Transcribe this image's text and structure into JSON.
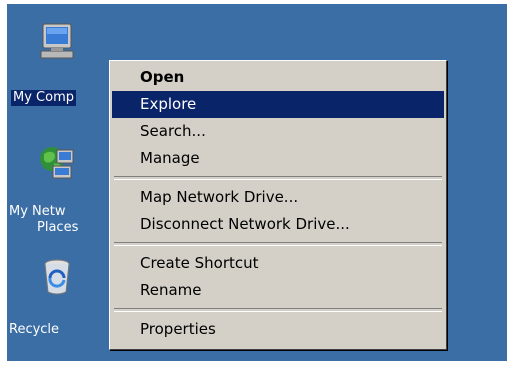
{
  "desktop": {
    "background_color": "#3a6ea5",
    "selection_color": "#0a246a",
    "icons": [
      {
        "label": "My Comp",
        "icon": "computer-icon"
      },
      {
        "label": "My Netw",
        "label2": "Places",
        "icon": "network-places-icon"
      },
      {
        "label": "Recycle",
        "icon": "recycle-bin-icon"
      }
    ]
  },
  "context_menu": {
    "groups": [
      [
        {
          "label": "Open",
          "bold": true,
          "selected": false
        },
        {
          "label": "Explore",
          "bold": false,
          "selected": true
        },
        {
          "label": "Search...",
          "bold": false,
          "selected": false
        },
        {
          "label": "Manage",
          "bold": false,
          "selected": false
        }
      ],
      [
        {
          "label": "Map Network Drive...",
          "bold": false,
          "selected": false
        },
        {
          "label": "Disconnect Network Drive...",
          "bold": false,
          "selected": false
        }
      ],
      [
        {
          "label": "Create Shortcut",
          "bold": false,
          "selected": false
        },
        {
          "label": "Rename",
          "bold": false,
          "selected": false
        }
      ],
      [
        {
          "label": "Properties",
          "bold": false,
          "selected": false
        }
      ]
    ]
  }
}
